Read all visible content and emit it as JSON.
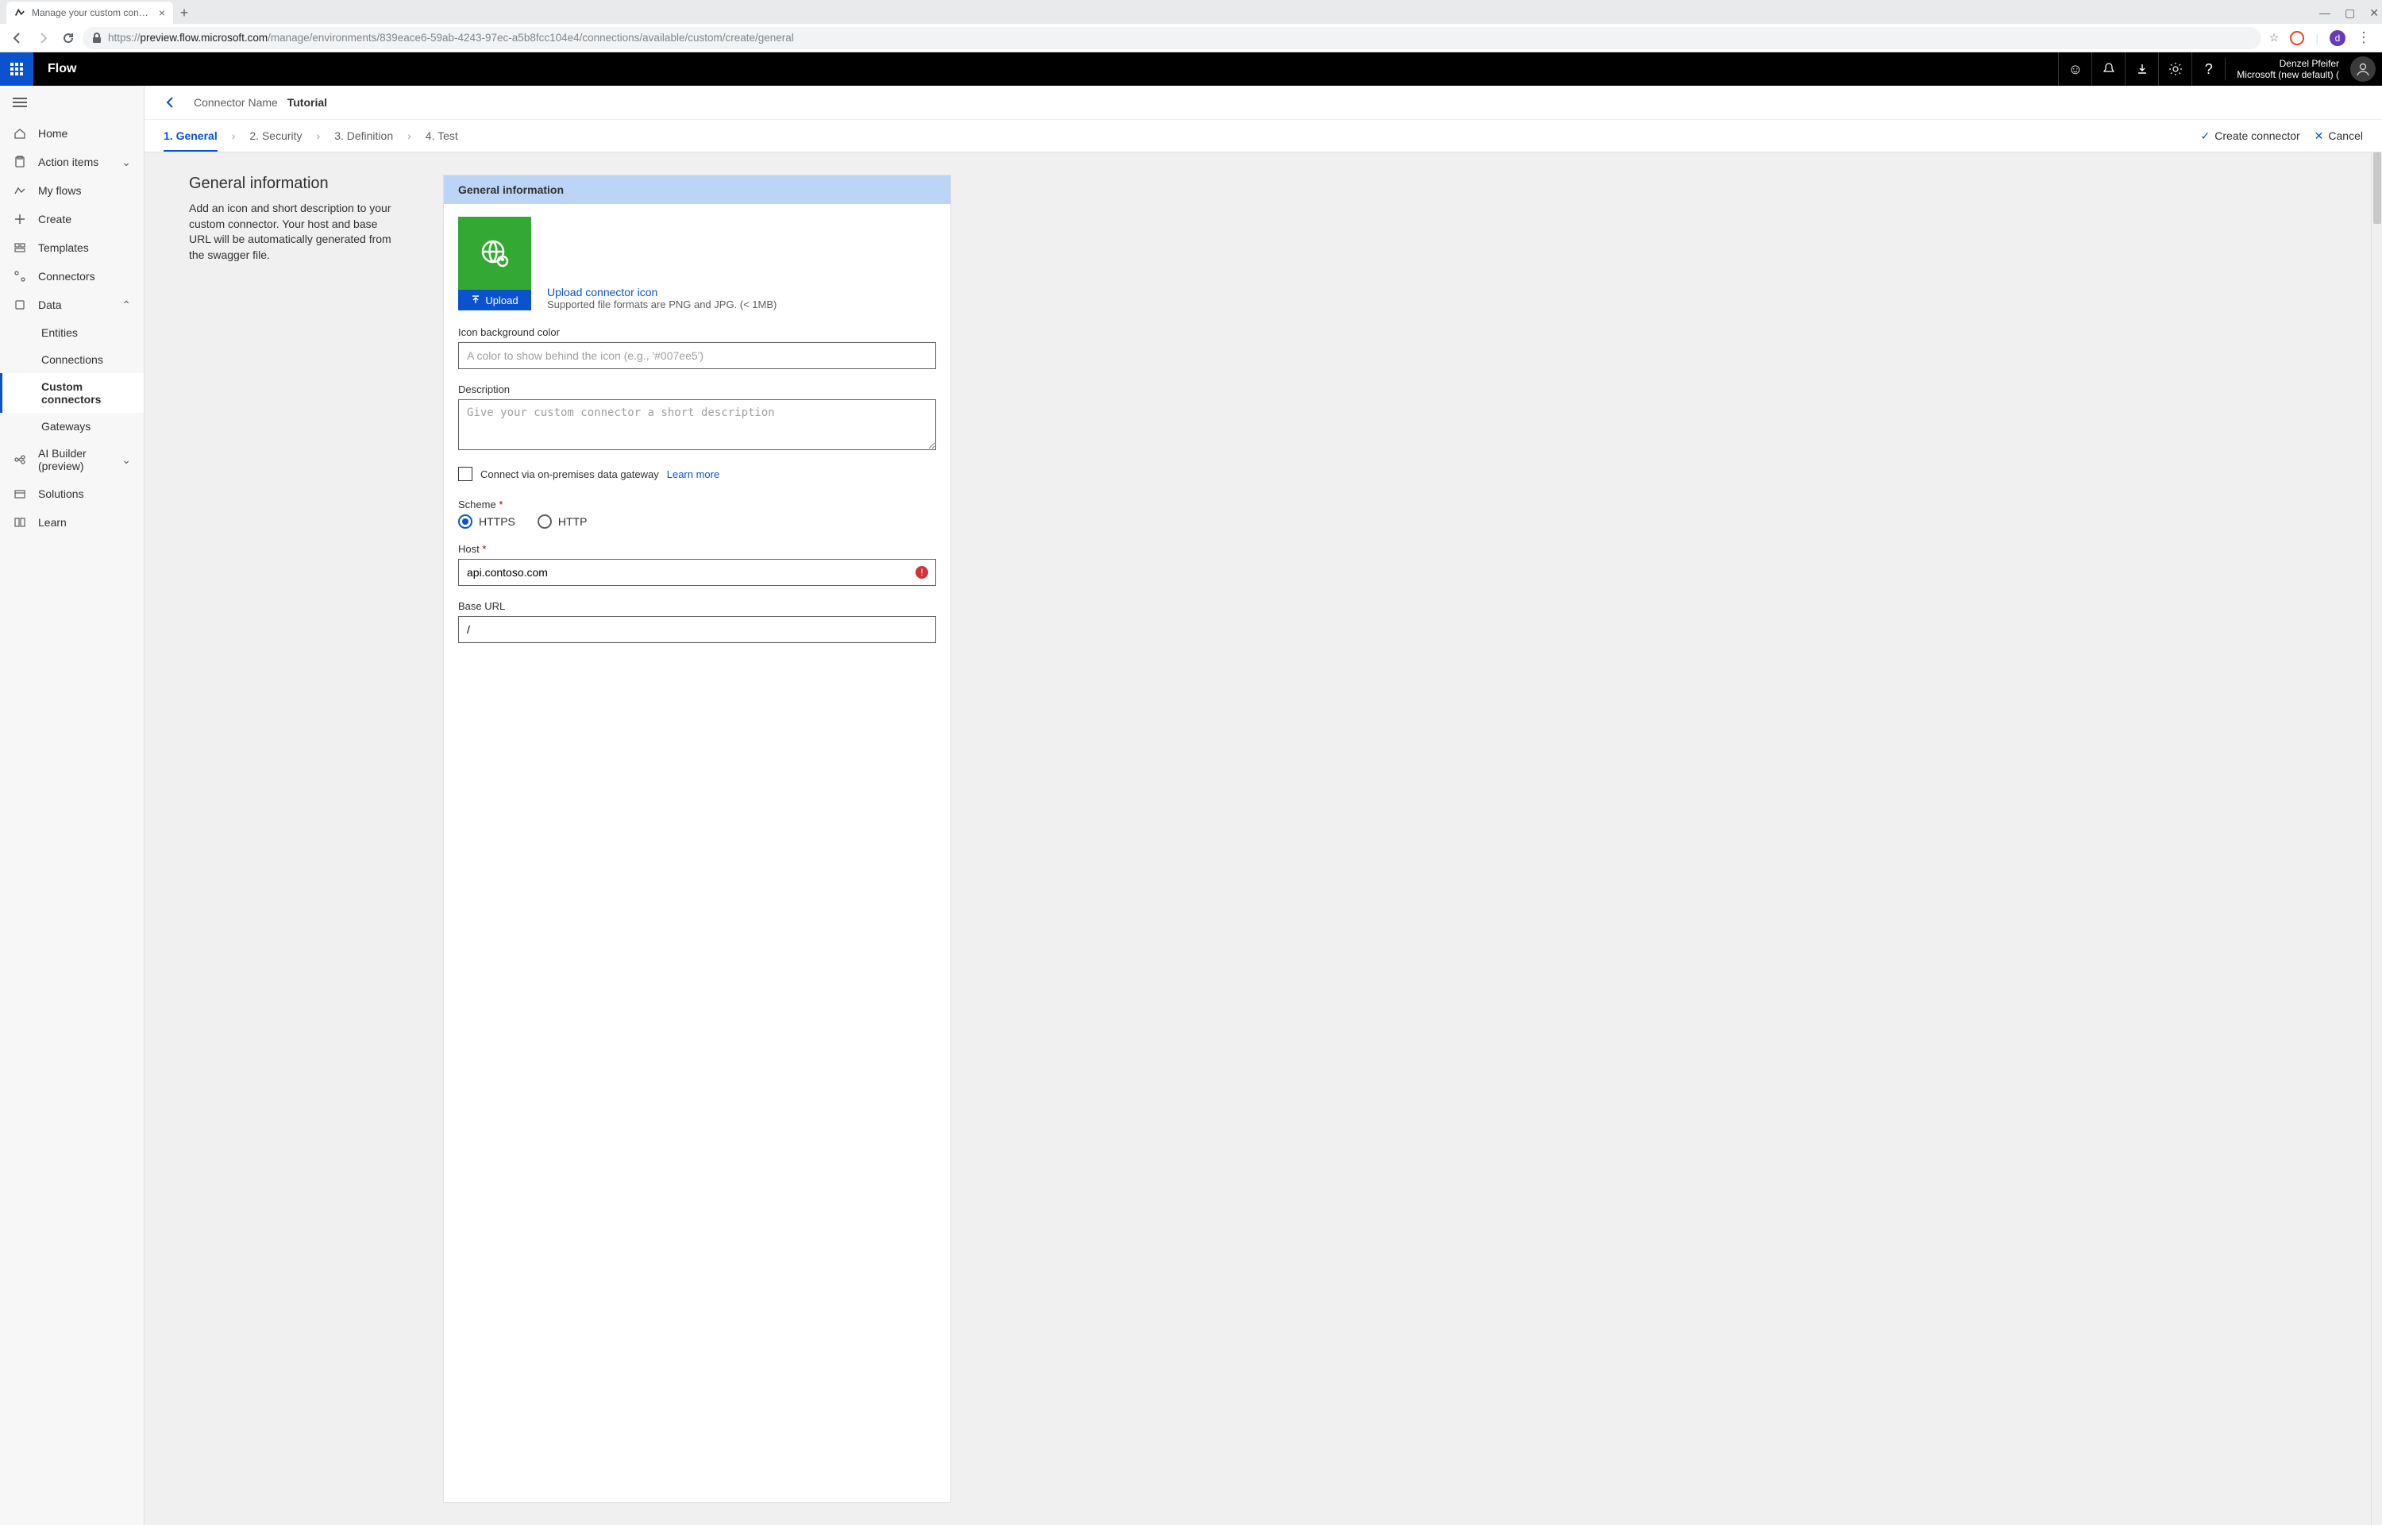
{
  "browser": {
    "tab_title": "Manage your custom connectors",
    "url_scheme": "https://",
    "url_host": "preview.flow.microsoft.com",
    "url_path": "/manage/environments/839eace6-59ab-4243-97ec-a5b8fcc104e4/connections/available/custom/create/general",
    "avatar_letter": "d"
  },
  "header": {
    "brand": "Flow",
    "user_name": "Denzel Pfeifer",
    "tenant": "Microsoft (new default) ("
  },
  "sidebar": {
    "home": "Home",
    "action_items": "Action items",
    "my_flows": "My flows",
    "create": "Create",
    "templates": "Templates",
    "connectors": "Connectors",
    "data": "Data",
    "entities": "Entities",
    "connections": "Connections",
    "custom_connectors": "Custom connectors",
    "gateways": "Gateways",
    "ai_builder": "AI Builder (preview)",
    "solutions": "Solutions",
    "learn": "Learn"
  },
  "crumb": {
    "label": "Connector Name",
    "value": "Tutorial"
  },
  "steps": {
    "s1": "1. General",
    "s2": "2. Security",
    "s3": "3. Definition",
    "s4": "4. Test",
    "create": "Create connector",
    "cancel": "Cancel"
  },
  "intro": {
    "title": "General information",
    "desc": "Add an icon and short description to your custom connector. Your host and base URL will be automatically generated from the swagger file."
  },
  "card": {
    "header": "General information",
    "upload_btn": "Upload",
    "upload_link": "Upload connector icon",
    "upload_hint": "Supported file formats are PNG and JPG. (< 1MB)",
    "bg_label": "Icon background color",
    "bg_placeholder": "A color to show behind the icon (e.g., '#007ee5')",
    "desc_label": "Description",
    "desc_placeholder": "Give your custom connector a short description",
    "gateway_label": "Connect via on-premises data gateway",
    "learn_more": "Learn more",
    "scheme_label": "Scheme",
    "scheme_https": "HTTPS",
    "scheme_http": "HTTP",
    "host_label": "Host",
    "host_value": "api.contoso.com",
    "baseurl_label": "Base URL",
    "baseurl_value": "/"
  }
}
